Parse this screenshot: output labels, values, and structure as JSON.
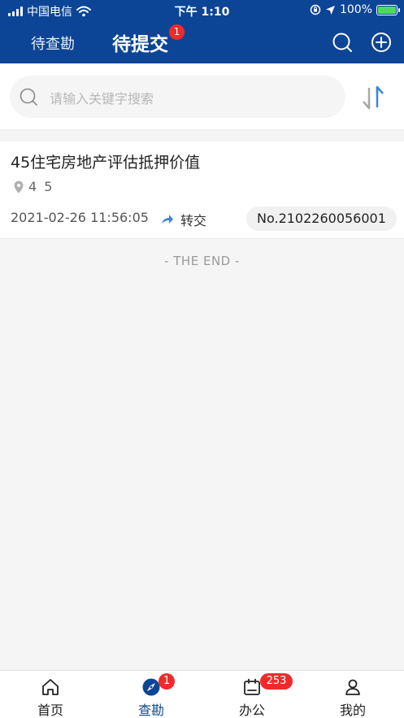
{
  "status_bar": {
    "carrier": "中国电信",
    "time": "下午 1:10",
    "battery": "100%"
  },
  "nav": {
    "tabs": [
      {
        "label": "待查勘",
        "active": false
      },
      {
        "label": "待提交",
        "active": true,
        "badge": "1"
      }
    ],
    "icons": [
      "search-icon",
      "add-circle-icon"
    ]
  },
  "search": {
    "placeholder": "请输入关键字搜索"
  },
  "list": {
    "items": [
      {
        "title": "45住宅房地产评估抵押价值",
        "location": "4 5",
        "date": "2021-02-26 11:56:05",
        "action": "转交",
        "number": "No.2102260056001"
      }
    ],
    "end_text": "- THE END -"
  },
  "tabbar": {
    "items": [
      {
        "label": "首页",
        "icon": "home-icon"
      },
      {
        "label": "查勘",
        "icon": "compass-icon",
        "badge": "1",
        "active": true
      },
      {
        "label": "办公",
        "icon": "calendar-icon",
        "badge": "253"
      },
      {
        "label": "我的",
        "icon": "user-icon"
      }
    ]
  },
  "colors": {
    "brand": "#0d4596",
    "badge": "#ee2b2b",
    "accent": "#3b86e0"
  }
}
